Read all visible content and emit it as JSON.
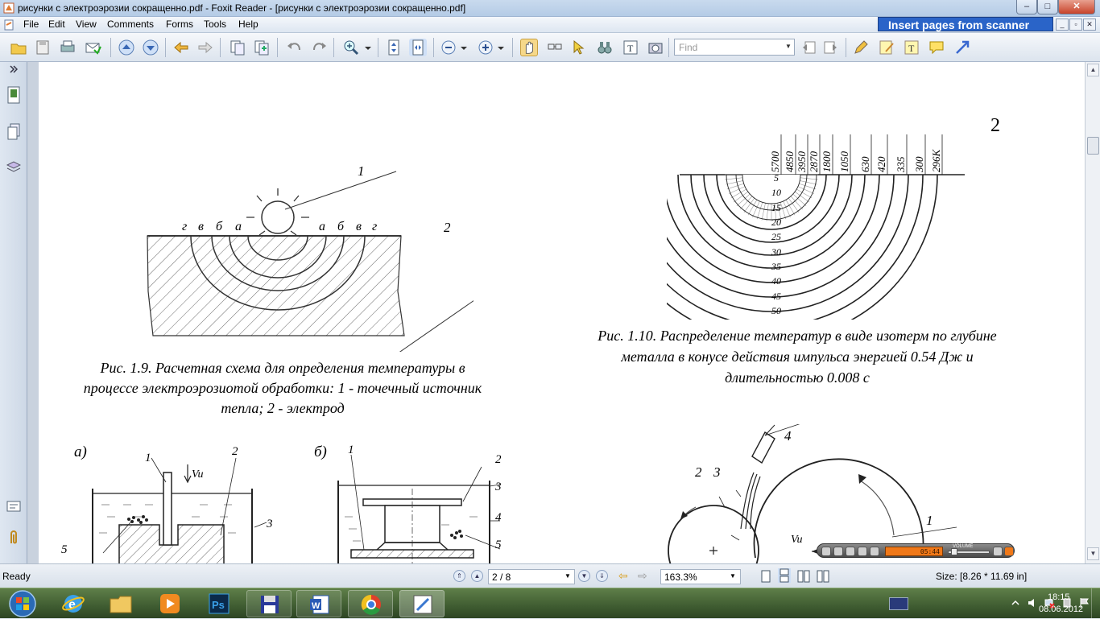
{
  "window": {
    "title": "рисунки с электроэрозии сокращенно.pdf - Foxit Reader - [рисунки с электроэрозии сокращенно.pdf]",
    "min": "–",
    "max": "□",
    "close": "✕"
  },
  "menu": [
    "File",
    "Edit",
    "View",
    "Comments",
    "Forms",
    "Tools",
    "Help"
  ],
  "scanner_banner": "Insert pages from scanner",
  "toolbar": {
    "find_placeholder": "Find"
  },
  "page": {
    "number": "2",
    "fig19": {
      "labels": {
        "one": "1",
        "two": "2",
        "g": "г",
        "v": "в",
        "b": "б",
        "a": "а"
      },
      "caption_line1": "Рис. 1.9. Расчетная схема для определения температуры в",
      "caption_line2": "процессе электроэрозиотой обработки: 1 - точечный источник",
      "caption_line3": "тепла; 2 - электрод"
    },
    "fig110": {
      "temps": [
        "5700",
        "4850",
        "3950",
        "2870",
        "1800",
        "1050",
        "630",
        "420",
        "335",
        "300",
        "296K"
      ],
      "depths": [
        "5",
        "10",
        "15",
        "20",
        "25",
        "30",
        "35",
        "40",
        "45",
        "50"
      ],
      "caption_line1": "Рис. 1.10. Распределение температур в виде изотерм по глубине",
      "caption_line2": "металла в конусе действия импульса энергией 0.54 Дж и",
      "caption_line3": "длительностью 0.008 с"
    },
    "fig_bottom_left": {
      "a_label": "а)",
      "b_label": "б)",
      "labels_a": {
        "one": "1",
        "two": "2",
        "three": "3",
        "five": "5",
        "vu": "Vu"
      },
      "labels_b": {
        "one": "1",
        "two": "2",
        "three": "3",
        "four": "4",
        "five": "5"
      }
    },
    "fig_bottom_right": {
      "labels": {
        "one": "1",
        "two": "2",
        "three": "3",
        "four": "4",
        "vu": "Vu"
      }
    },
    "media_player": {
      "time": "05:44",
      "volume_label": "VOLUME"
    }
  },
  "status": {
    "ready": "Ready",
    "page": "2 / 8",
    "zoom": "163.3%",
    "size": "Size: [8.26 * 11.69 in]"
  },
  "taskbar": {
    "time": "18:15",
    "date": "08.06.2012"
  }
}
